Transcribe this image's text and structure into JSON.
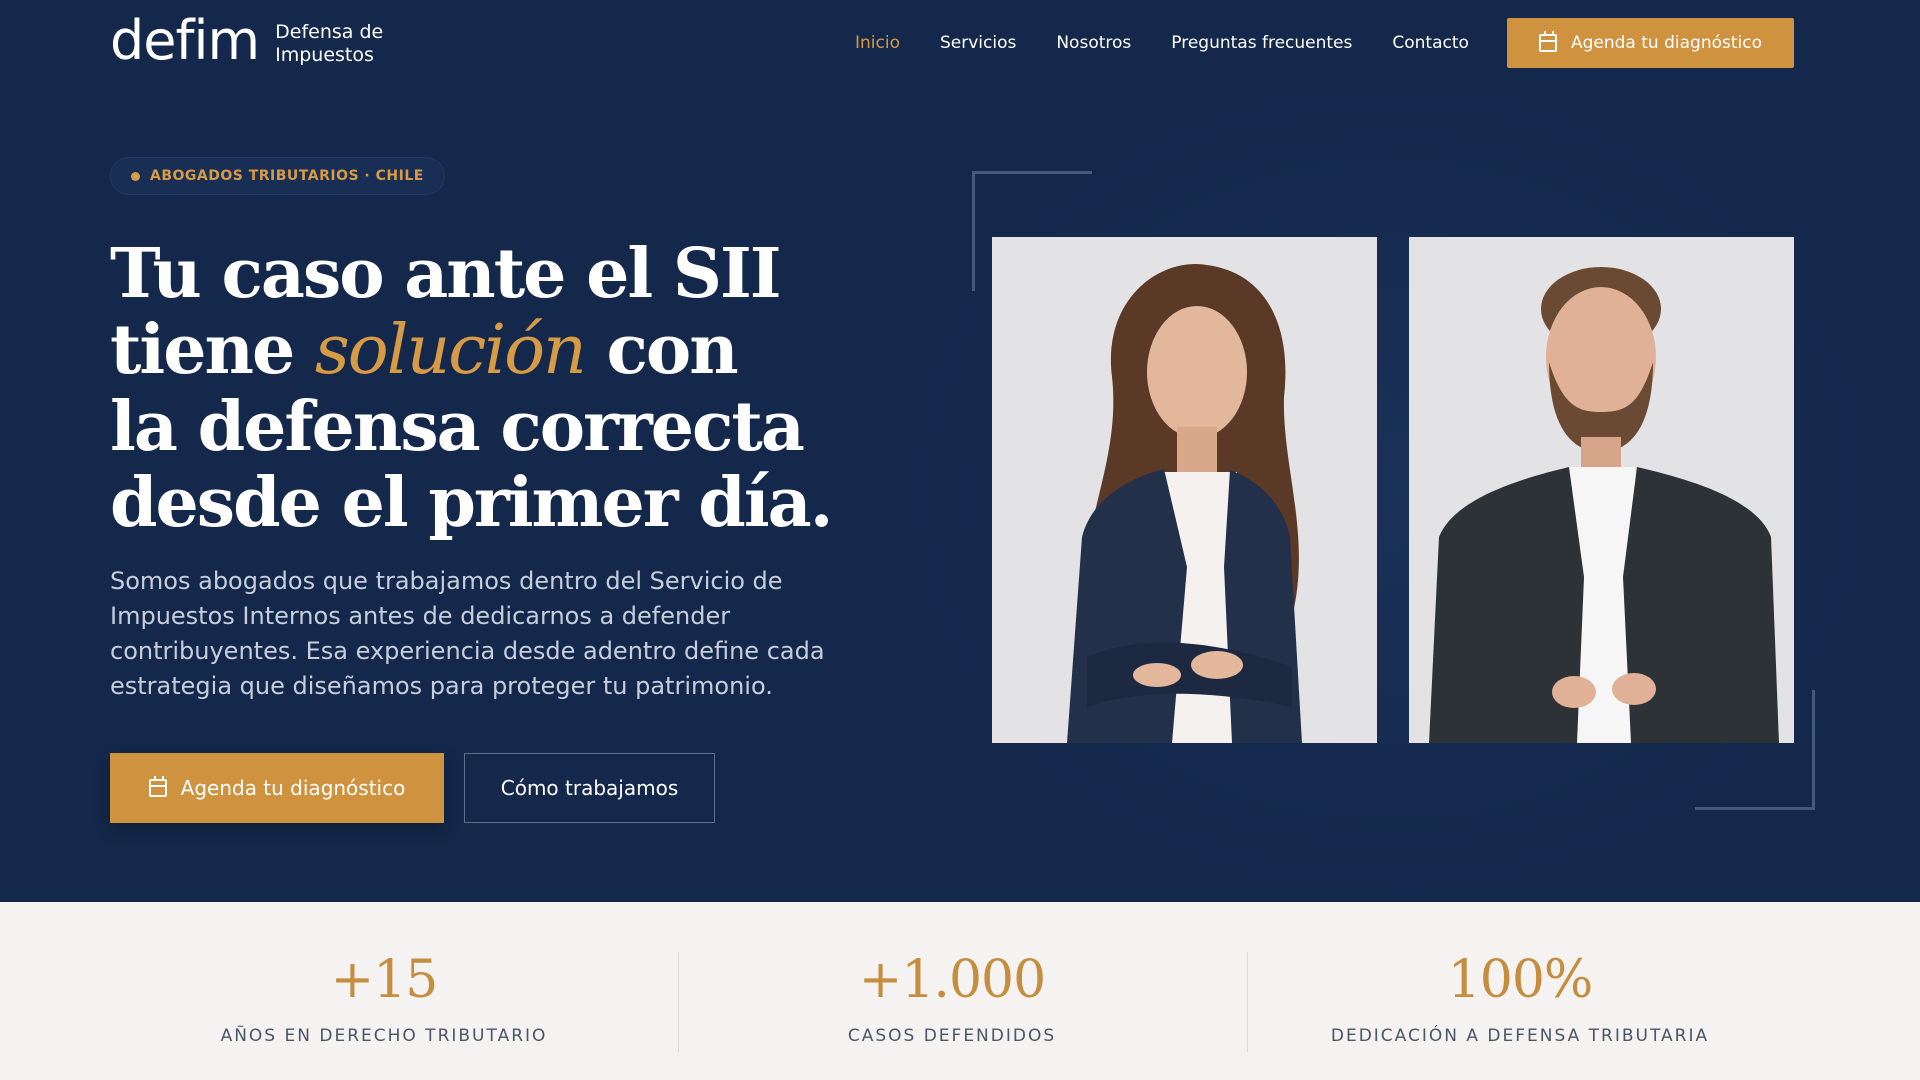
{
  "header": {
    "logo_word": "defim",
    "logo_sub_line1": "Defensa de",
    "logo_sub_line2": "Impuestos",
    "nav": [
      {
        "label": "Inicio",
        "active": true
      },
      {
        "label": "Servicios",
        "active": false
      },
      {
        "label": "Nosotros",
        "active": false
      },
      {
        "label": "Preguntas frecuentes",
        "active": false
      },
      {
        "label": "Contacto",
        "active": false
      }
    ],
    "cta_label": "Agenda tu diagnóstico",
    "cta_icon": "calendar-icon"
  },
  "hero": {
    "badge": "ABOGADOS TRIBUTARIOS · CHILE",
    "headline_line1": "Tu caso ante el SII",
    "headline_line2_pre": "tiene ",
    "headline_line2_accent": "solución",
    "headline_line2_post": " con",
    "headline_line3": "la defensa correcta",
    "headline_line4": "desde el primer día.",
    "lead": "Somos abogados que trabajamos dentro del Servicio de Impuestos Internos antes de dedicarnos a defender contribuyentes. Esa experiencia desde adentro define cada estrategia que diseñamos para proteger tu patrimonio.",
    "primary_button": "Agenda tu diagnóstico",
    "secondary_button": "Cómo trabajamos"
  },
  "stats": [
    {
      "value": "+15",
      "label": "AÑOS EN DERECHO TRIBUTARIO"
    },
    {
      "value": "+1.000",
      "label": "CASOS DEFENDIDOS"
    },
    {
      "value": "100%",
      "label": "DEDICACIÓN A DEFENSA TRIBUTARIA"
    }
  ],
  "colors": {
    "navy": "#13284b",
    "accent": "#cf923f",
    "stats_bg": "#f4f3f1"
  }
}
